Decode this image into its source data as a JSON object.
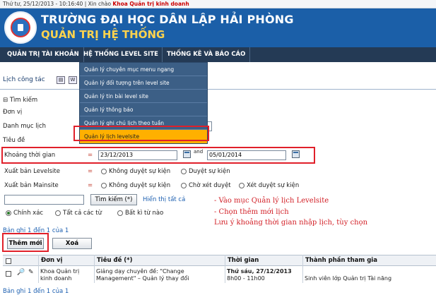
{
  "topbar": {
    "text": "Thứ tư, 25/12/2013 - 10:16:40 | Xin chào ",
    "user": "Khoa Quản trị kinh doanh"
  },
  "header": {
    "title": "TRƯỜNG ĐẠI HỌC DÂN LẬP HẢI PHÒNG",
    "subtitle": "QUẢN TRỊ HỆ THỐNG"
  },
  "menu": {
    "items": [
      "QUẢN TRỊ TÀI KHOẢN",
      "HỆ THỐNG LEVEL SITE",
      "THỐNG KÊ VÀ BÁO CÁO"
    ]
  },
  "dropdown": {
    "items": [
      "Quản lý chuyên mục menu ngang",
      "Quản lý đối tượng trên level site",
      "Quản lý tin bài level site",
      "Quản lý thông báo",
      "Quản lý ghi chú lịch theo tuần",
      "Quản lý lịch levelsite"
    ]
  },
  "page": {
    "title": "Lịch công tác",
    "search_toggle": "Tìm kiếm"
  },
  "form": {
    "don_vi": "Đơn vị",
    "danh_muc": "Danh mục lịch",
    "tieu_de": "Tiêu đề",
    "khoang_tg": "Khoảng thời gian",
    "eq": "=",
    "from_date": "23/12/2013",
    "and": "and",
    "to_date": "05/01/2014",
    "xb_levelsite": "Xuất bản Levelsite",
    "xb_mainsite": "Xuất bản Mainsite",
    "opt_khong_duyet": "Không duyệt sự kiện",
    "opt_duyet": "Duyệt sự kiện",
    "opt_cho_xet": "Chờ xét duyệt",
    "opt_xet_duyet": "Xét duyệt sự kiện",
    "search_btn": "Tìm kiếm (*)",
    "show_all": "Hiển thị tất cả",
    "match_exact": "Chính xác",
    "match_all": "Tất cả các từ",
    "match_any": "Bất kì từ nào"
  },
  "notes": {
    "line1": "- Vào mục Quản lý lịch Levelsite",
    "line2": "- Chọn thêm mới lịch",
    "line3": "Lưu ý khoảng thời gian nhập lịch, tùy chọn"
  },
  "records": {
    "top": "Bản ghi 1 đến 1 của 1",
    "bottom": "Bản ghi 1 đến 1 của 1"
  },
  "buttons": {
    "add": "Thêm mới",
    "delete": "Xoá"
  },
  "table": {
    "headers": [
      "Đơn vị",
      "Tiêu đề (*)",
      "Thời gian",
      "Thành phần tham gia"
    ],
    "row": {
      "unit": [
        "Khoa Quản trị",
        "kinh doanh"
      ],
      "title": [
        "Giảng dạy chuyên đề: \"Change",
        "Management\" – Quản lý thay đổi"
      ],
      "time_day": "Thứ sáu, 27/12/2013",
      "time_range": "8h00  -  11h00",
      "participants": "Sinh viên lớp Quản trị Tài năng"
    }
  },
  "colors": {
    "header_bg": "#1b5fa8",
    "subtitle": "#ffd34d",
    "menubar": "#243a55",
    "dropdown_bg": "#3c5f86",
    "active_item": "#ffb000",
    "annotation": "#e0202a"
  }
}
